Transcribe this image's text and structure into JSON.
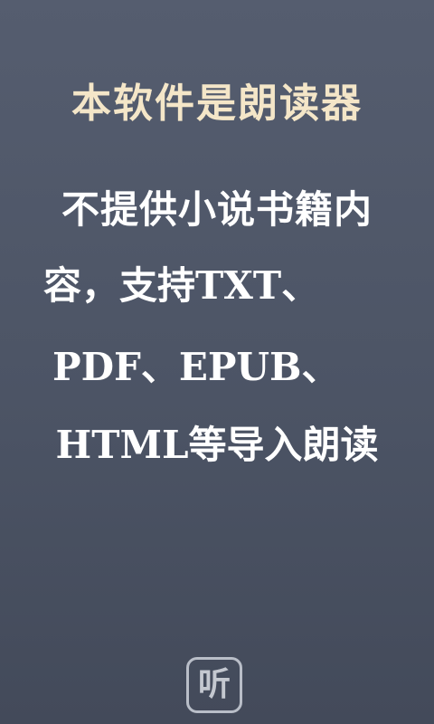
{
  "splash": {
    "headline": "本软件是朗读器",
    "lines": [
      "不提供小说书籍内",
      "容，支持TXT、",
      "PDF、EPUB、",
      "HTML等导入朗读"
    ]
  },
  "logo": {
    "icon": "listen-logo-icon",
    "glyph": "听"
  },
  "colors": {
    "background_top": "#555d6f",
    "background_bottom": "#434a5a",
    "headline": "#f4e6c8",
    "body_text": "#ffffff"
  }
}
